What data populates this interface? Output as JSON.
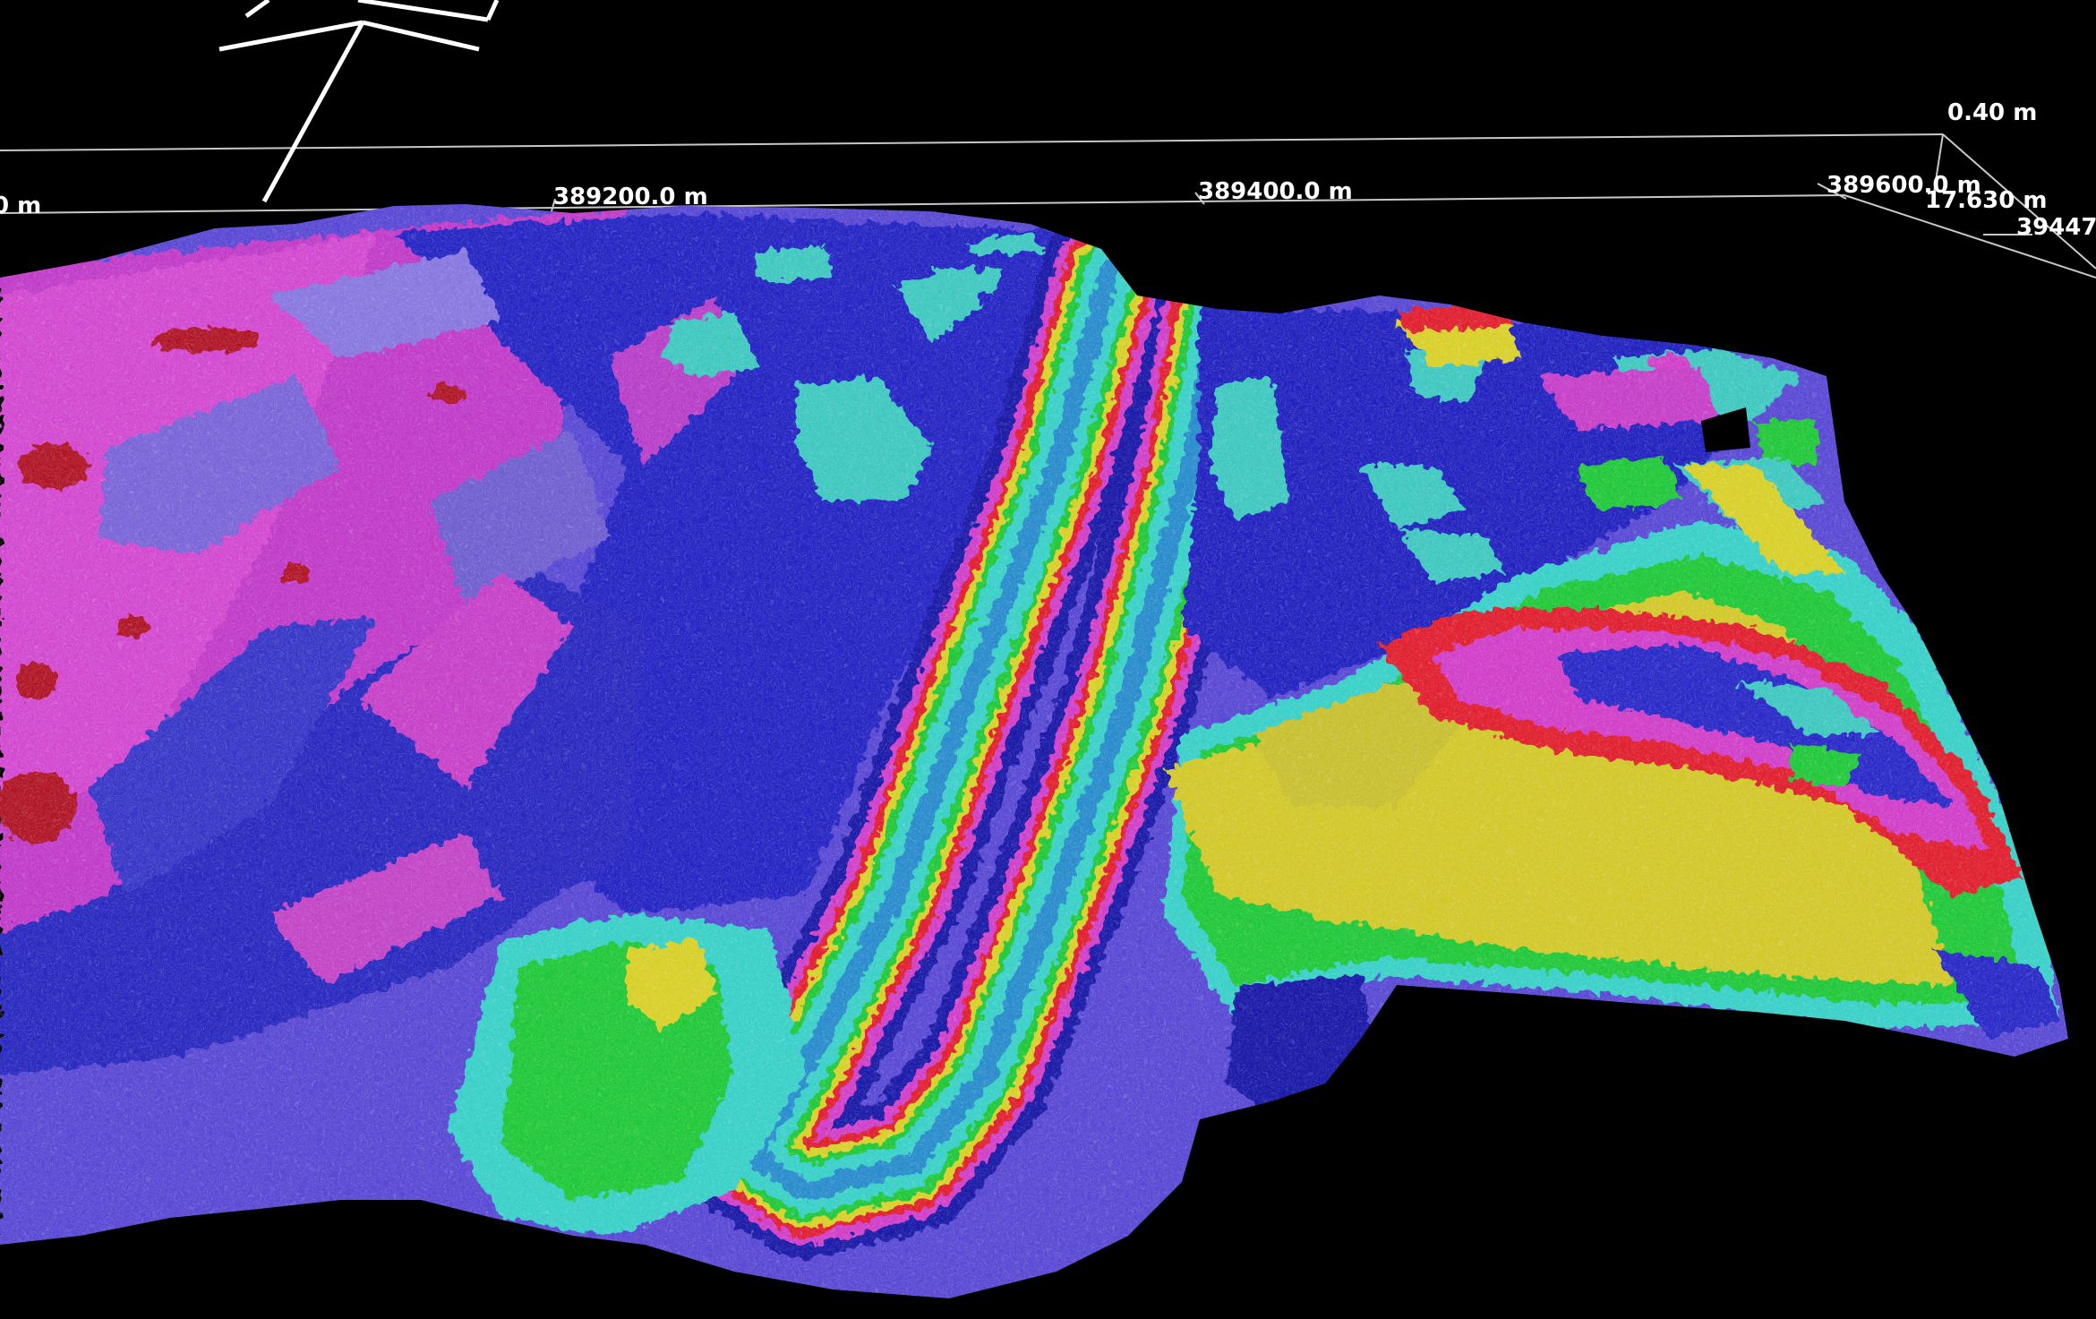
{
  "viewer": {
    "background": "#000000",
    "axis_color": "#c8c8c8",
    "label_color": "#ffffff"
  },
  "axes": {
    "x_ticks": [
      "389200.0 m",
      "389400.0 m",
      "389600.0 m"
    ],
    "x_edge_label": "0 m",
    "z_label": "0.40 m",
    "corner_label": "17.630 m",
    "y_label": "39447"
  },
  "surface": {
    "description_colormap": [
      "#8a0010",
      "#cc1a2a",
      "#e03cb8",
      "#b84ad8",
      "#6a5ae0",
      "#2a2ac8",
      "#1a1aa8",
      "#3ad0c8",
      "#22c83a",
      "#d8d02a"
    ],
    "low_color": "#1a1aa8",
    "mid_color": "#3ad0c8",
    "high_color": "#d8d02a"
  }
}
